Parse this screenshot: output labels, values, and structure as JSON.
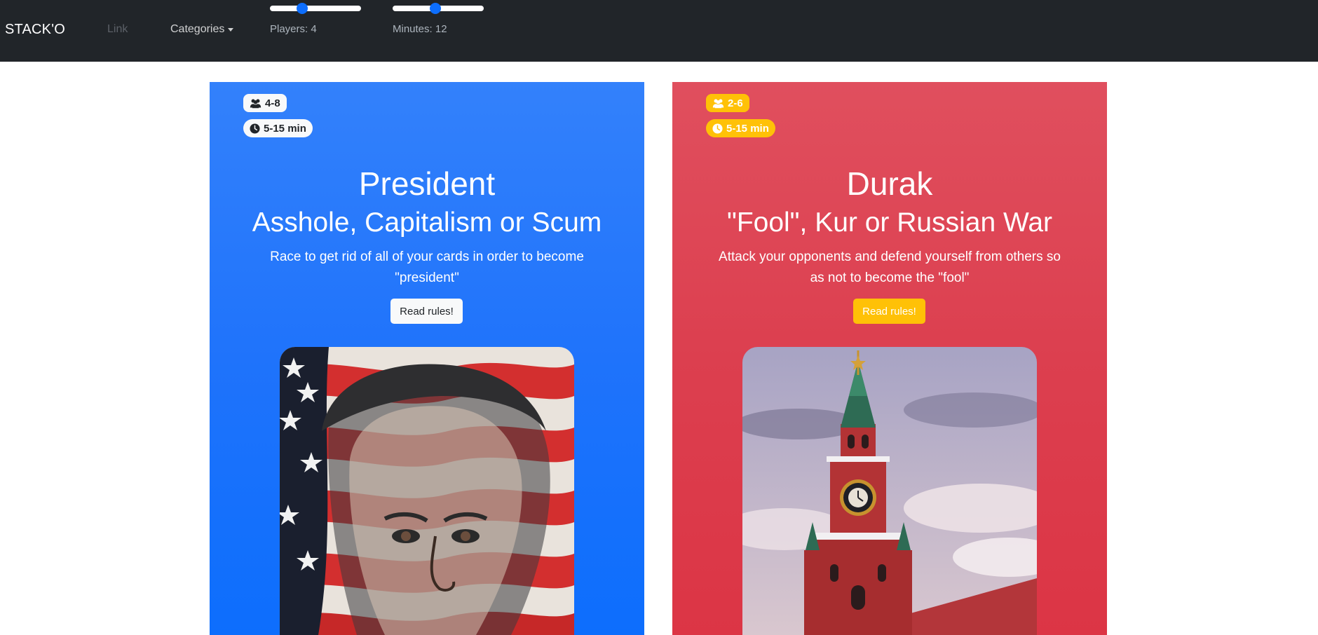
{
  "navbar": {
    "brand": "STACK'O",
    "link_label": "Link",
    "categories_label": "Categories",
    "players_slider": {
      "caption": "Players: 4",
      "value": 4,
      "fraction": 0.35
    },
    "minutes_slider": {
      "caption": "Minutes: 12",
      "value": 12,
      "fraction": 0.47
    }
  },
  "cards": [
    {
      "players_badge": "4-8",
      "time_badge": "5-15 min",
      "title": "President",
      "subtitle": "Asshole, Capitalism or Scum",
      "description": "Race to get rid of all of your cards in order to become \"president\"",
      "button_label": "Read rules!",
      "accent_color": "#0d6efd",
      "image_icon": "lincoln-flag-illustration"
    },
    {
      "players_badge": "2-6",
      "time_badge": "5-15 min",
      "title": "Durak",
      "subtitle": "\"Fool\", Kur or Russian War",
      "description": "Attack your opponents and defend yourself from others so as not to become the \"fool\"",
      "button_label": "Read rules!",
      "accent_color": "#dc3545",
      "image_icon": "kremlin-tower-illustration"
    }
  ]
}
